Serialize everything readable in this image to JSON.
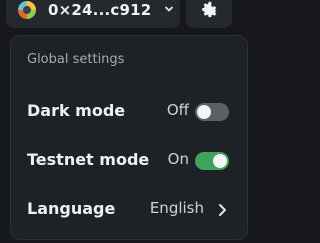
{
  "wallet": {
    "address": "0×24...c912",
    "avatar_icon": "wallet-avatar",
    "dropdown_icon": "chevron-down-icon"
  },
  "settings_button": {
    "icon": "gear-icon"
  },
  "menu": {
    "title": "Global settings",
    "items": [
      {
        "label": "Dark mode",
        "value": "Off",
        "toggle_on": false
      },
      {
        "label": "Testnet mode",
        "value": "On",
        "toggle_on": true
      },
      {
        "label": "Language",
        "value": "English",
        "icon": "chevron-right-icon"
      }
    ]
  },
  "colors": {
    "toggle_off": "#5a5f66",
    "toggle_on": "#3da35d",
    "background": "#16181c",
    "menu_background": "#1e2126"
  }
}
